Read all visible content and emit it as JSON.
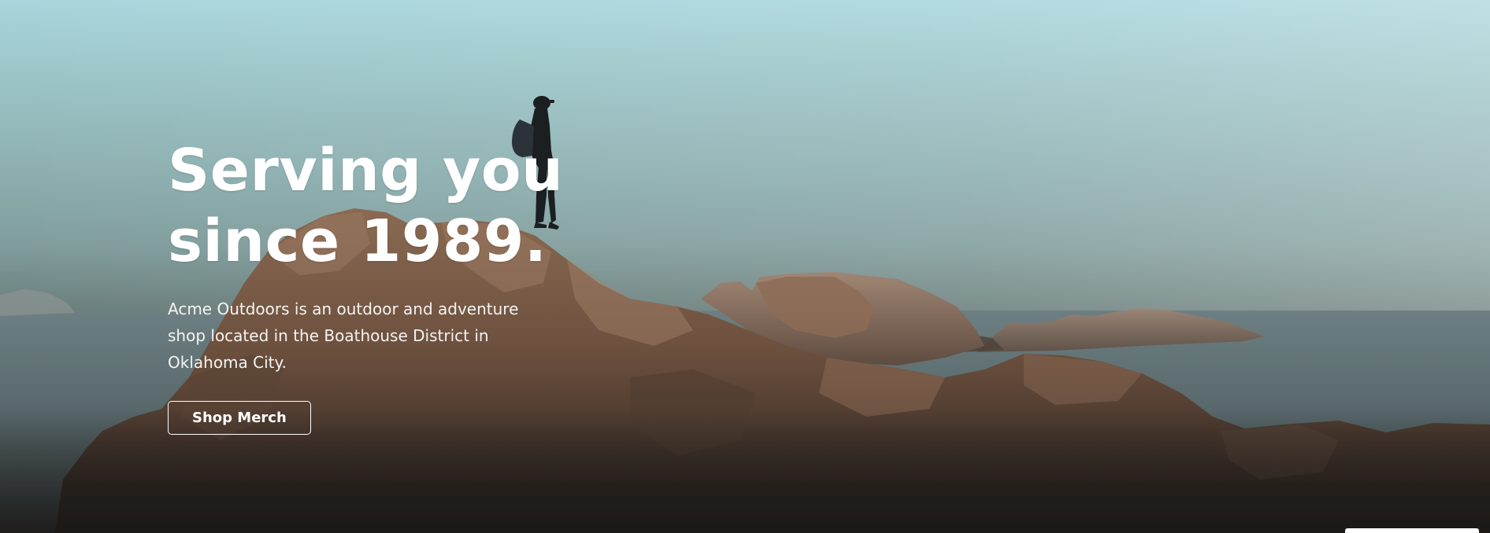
{
  "hero": {
    "headline_line1": "Serving you",
    "headline_line2": "since 1989.",
    "description": "Acme Outdoors is an outdoor and adventure shop located in the Boathouse District in Oklahoma City.",
    "cta_label": "Shop Merch"
  },
  "colors": {
    "sky_top": "#a9d6dc",
    "sea": "#55656a",
    "rock": "#7a5a44",
    "button_border": "#ffffff",
    "text": "#ffffff"
  }
}
